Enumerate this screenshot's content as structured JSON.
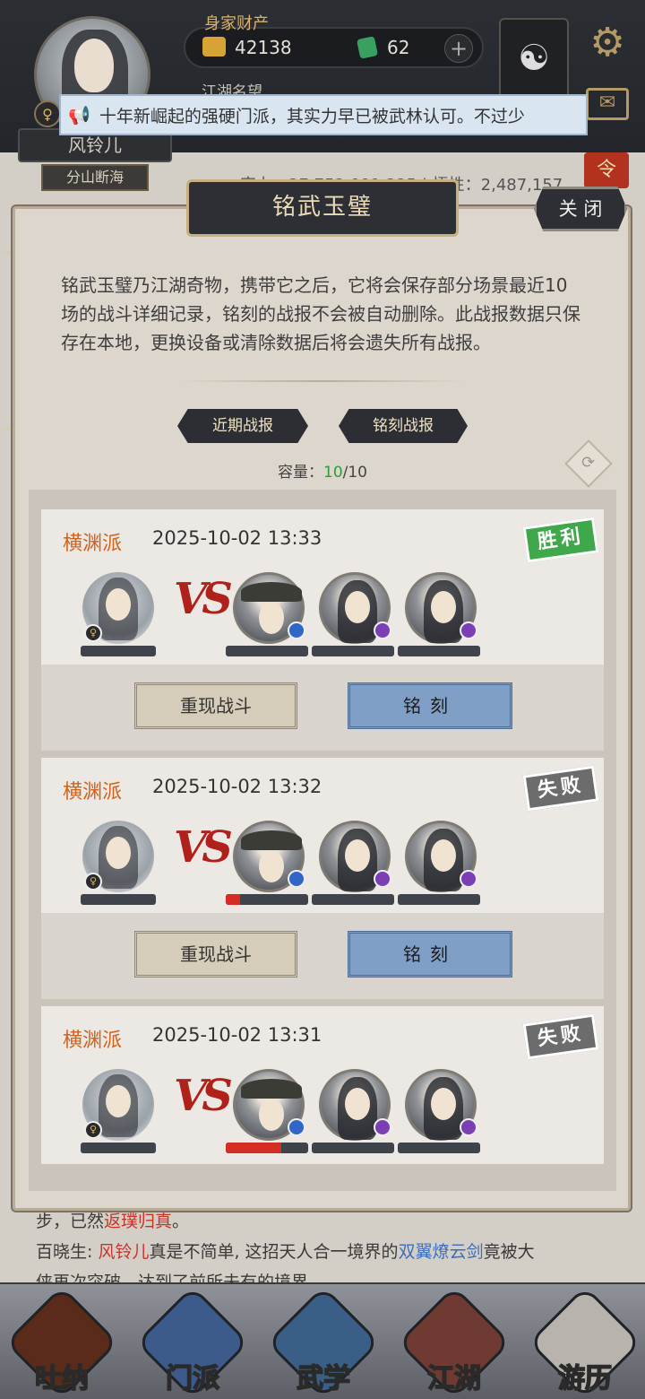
{
  "header": {
    "wealth_label": "身家财产",
    "gold": "42138",
    "jade": "62",
    "add": "+",
    "fame_label": "江湖名望",
    "player_name": "风铃儿",
    "player_title": "分山断海",
    "gender": "♀",
    "stats": "实力：27,752,091,225 | 悟性：2,487,157",
    "order_badge": "令",
    "taiji": "☯",
    "gear": "⚙",
    "mail": "✉"
  },
  "announcement": {
    "icon": "📢",
    "text": "十年新崛起的强硬门派，其实力早已被武林认可。不过少"
  },
  "modal": {
    "title": "铭武玉璧",
    "close": "关 闭",
    "description": "铭武玉璧乃江湖奇物，携带它之后，它将会保存部分场景最近10场的战斗详细记录，铭刻的战报不会被自动删除。此战报数据只保存在本地，更换设备或清除数据后将会遗失所有战报。",
    "tabs": [
      "近期战报",
      "铭刻战报"
    ],
    "capacity_label": "容量：",
    "capacity_used": "10",
    "capacity_total": "/10",
    "refresh_icon": "⟳"
  },
  "battles": [
    {
      "faction": "横渊派",
      "time": "2025-10-02 13:33",
      "result": "胜利",
      "result_type": "win",
      "replay": "重现战斗",
      "engrave": "铭刻",
      "enemy_hp_lost": [
        0,
        0,
        0
      ],
      "vs": "VS"
    },
    {
      "faction": "横渊派",
      "time": "2025-10-02 13:32",
      "result": "失败",
      "result_type": "lose",
      "replay": "重现战斗",
      "engrave": "铭刻",
      "enemy_hp_lost": [
        0.17,
        0,
        0
      ],
      "vs": "VS"
    },
    {
      "faction": "横渊派",
      "time": "2025-10-02 13:31",
      "result": "失败",
      "result_type": "lose",
      "enemy_hp_lost": [
        0.67,
        0,
        0
      ],
      "vs": "VS"
    }
  ],
  "log": {
    "line1_pre": "步，已然",
    "line1_red": "返璞归真",
    "line1_post": "。",
    "line2_speaker": "百晓生: ",
    "line2_name": "风铃儿",
    "line2_mid": "真是不简单, 这招天人合一境界的",
    "line2_skill": "双翼燎云剑",
    "line2_post": "竟被大",
    "line3": "侠再次突破，达到了前所未有的境界"
  },
  "nav": [
    "吐纳",
    "门派",
    "武学",
    "江湖",
    "游历"
  ]
}
